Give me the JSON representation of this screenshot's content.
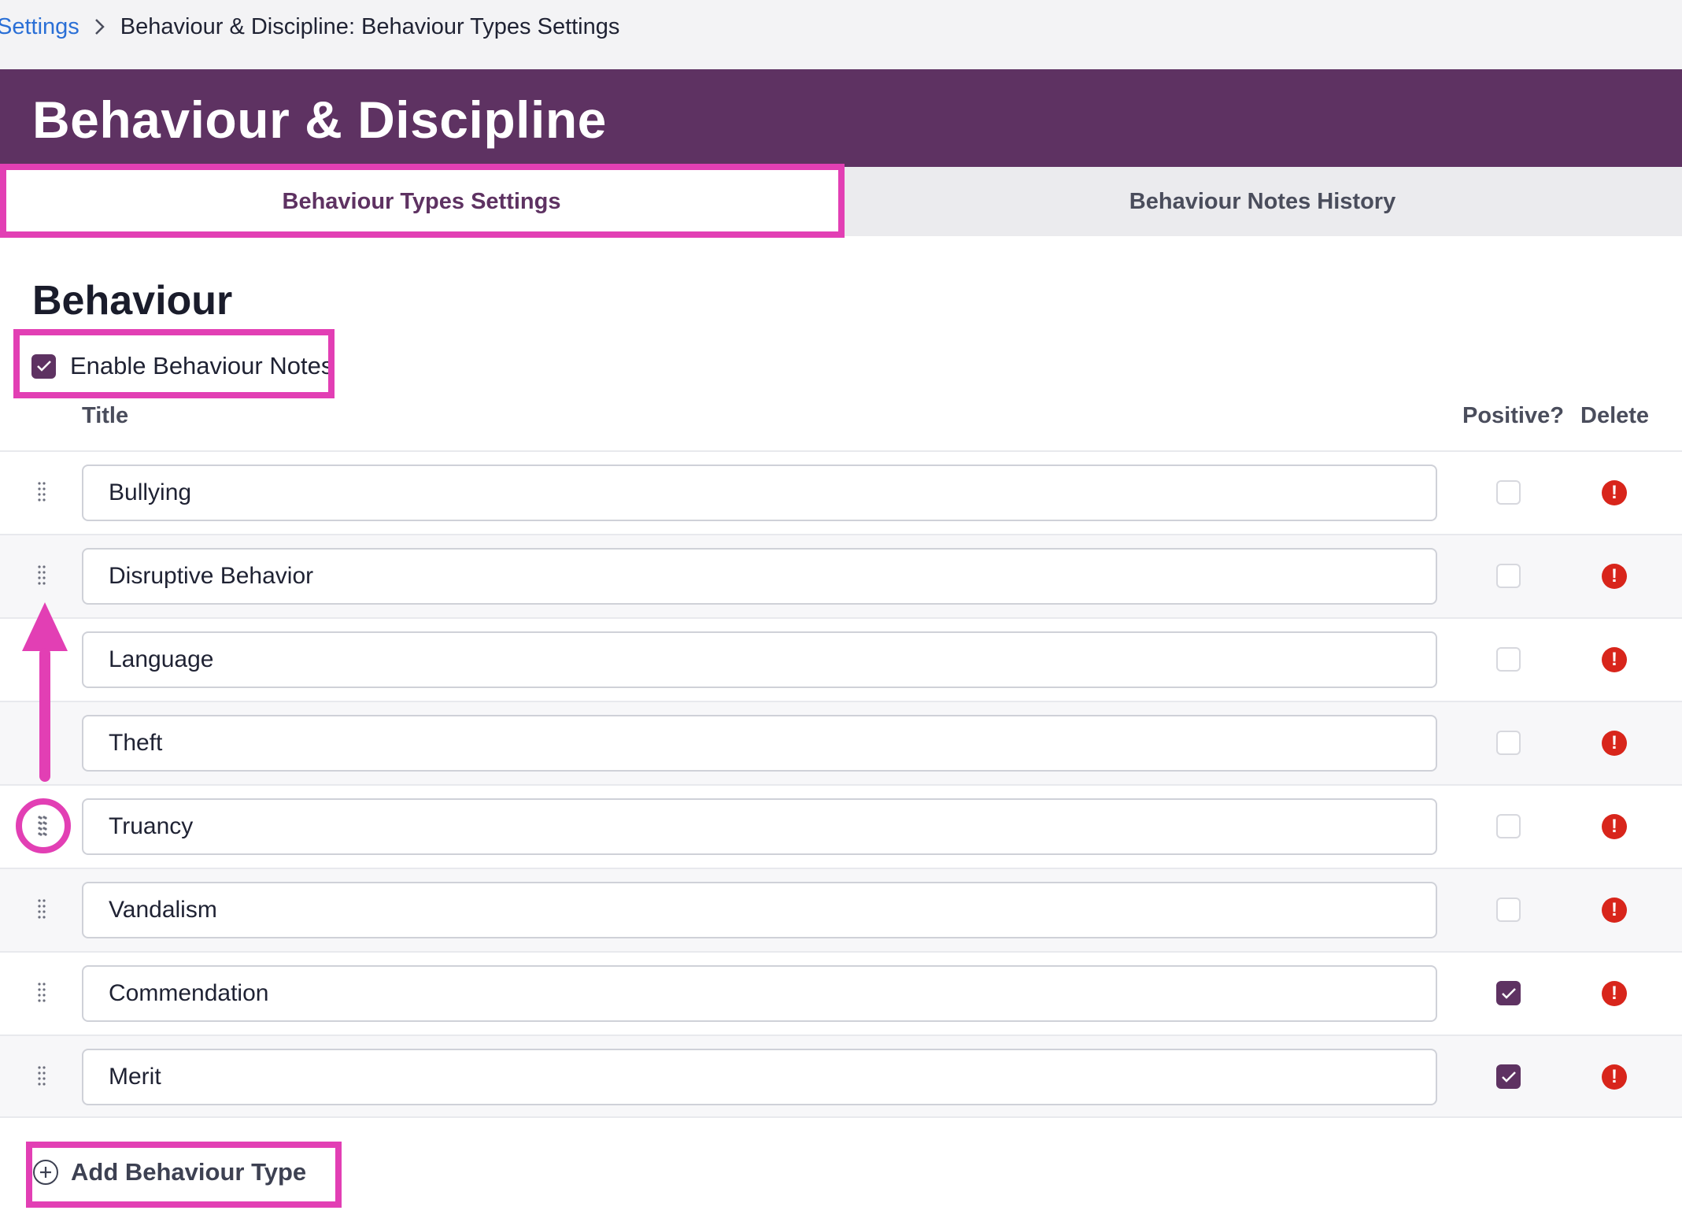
{
  "breadcrumb": {
    "parent": "Settings",
    "current": "Behaviour & Discipline: Behaviour Types Settings"
  },
  "header": {
    "title": "Behaviour & Discipline"
  },
  "tabs": [
    {
      "label": "Behaviour Types Settings",
      "active": true
    },
    {
      "label": "Behaviour Notes History",
      "active": false
    }
  ],
  "section": {
    "title": "Behaviour",
    "enable_label": "Enable Behaviour Notes",
    "enable_checked": true
  },
  "table": {
    "columns": {
      "title": "Title",
      "positive": "Positive?",
      "delete": "Delete"
    },
    "rows": [
      {
        "title": "Bullying",
        "positive": false
      },
      {
        "title": "Disruptive Behavior",
        "positive": false
      },
      {
        "title": "Language",
        "positive": false
      },
      {
        "title": "Theft",
        "positive": false
      },
      {
        "title": "Truancy",
        "positive": false
      },
      {
        "title": "Vandalism",
        "positive": false
      },
      {
        "title": "Commendation",
        "positive": true
      },
      {
        "title": "Merit",
        "positive": true
      }
    ]
  },
  "add_button": {
    "label": "Add Behaviour Type"
  },
  "colors": {
    "brand": "#5e3262",
    "link": "#2a6fd6",
    "danger": "#d8251b",
    "annotation": "#e23fb4"
  },
  "icons": {
    "breadcrumb_separator": "chevron-right-icon",
    "row_handle": "drag-handle-icon",
    "delete": "alert-circle-icon",
    "add": "plus-circle-icon",
    "checked": "check-icon"
  }
}
